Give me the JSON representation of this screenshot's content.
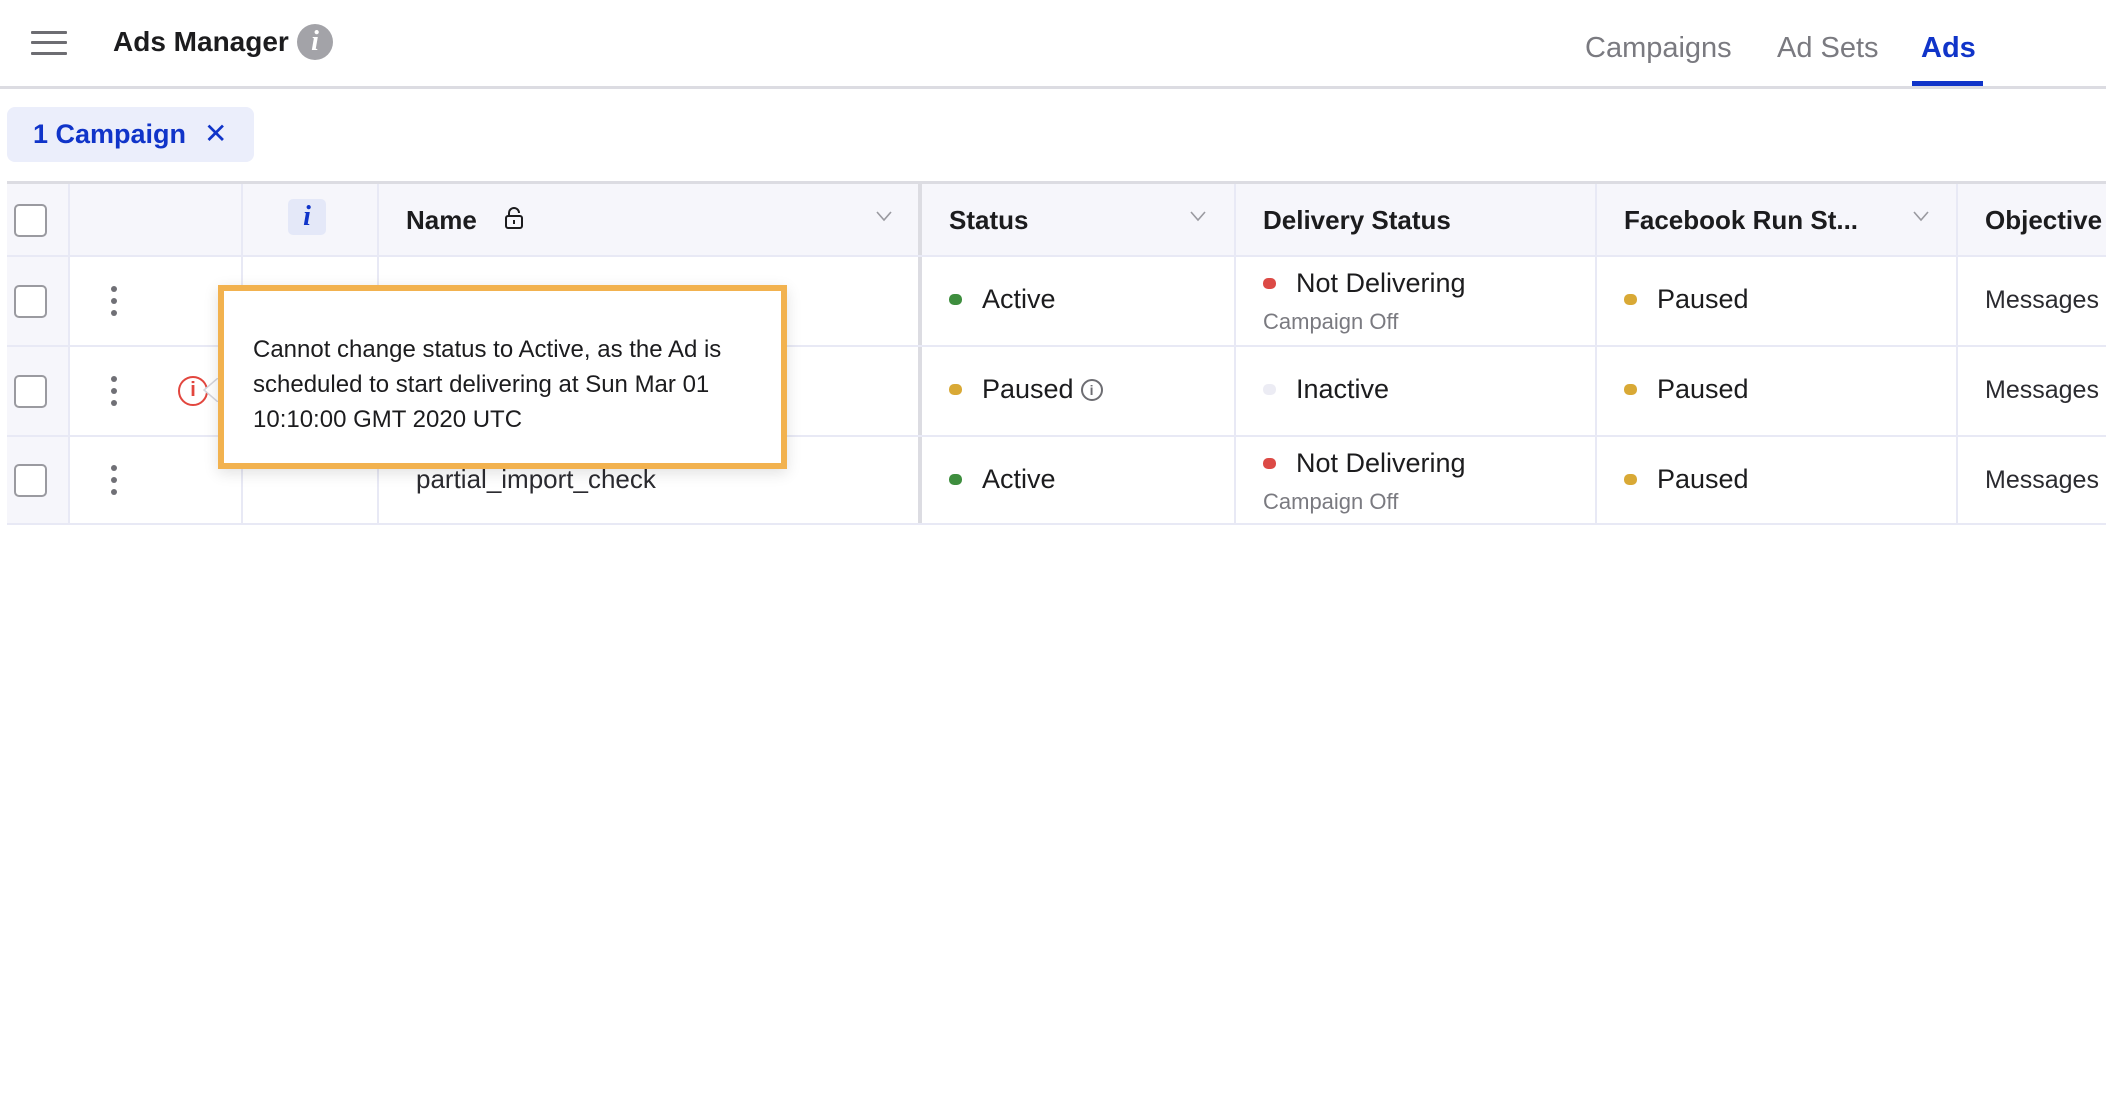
{
  "header": {
    "title": "Ads Manager",
    "title_info_icon": "i"
  },
  "tabs": [
    {
      "label": "Campaigns",
      "active": false
    },
    {
      "label": "Ad Sets",
      "active": false
    },
    {
      "label": "Ads",
      "active": true
    }
  ],
  "filter_chip": {
    "label": "1 Campaign",
    "close_glyph": "✕"
  },
  "colors": {
    "accent": "#1034c9",
    "active": "#3e8e3e",
    "paused": "#d9a935",
    "not_delivering": "#dc4a46",
    "inactive": "#ececf4",
    "error": "#e2463e",
    "tooltip_border": "#f2b24f"
  },
  "table": {
    "columns": [
      {
        "key": "select",
        "label": ""
      },
      {
        "key": "actions",
        "label": ""
      },
      {
        "key": "info",
        "label": "i"
      },
      {
        "key": "name",
        "label": "Name"
      },
      {
        "key": "status",
        "label": "Status"
      },
      {
        "key": "delivery_status",
        "label": "Delivery Status"
      },
      {
        "key": "facebook_run_status",
        "label": "Facebook Run St..."
      },
      {
        "key": "objective",
        "label": "Objective"
      }
    ],
    "rows": [
      {
        "name": "",
        "status": "Active",
        "delivery_status": "Not Delivering",
        "delivery_sub": "Campaign Off",
        "facebook_run_status": "Paused",
        "objective": "Messages"
      },
      {
        "name": "",
        "status": "Paused",
        "delivery_status": "Inactive",
        "delivery_sub": "",
        "facebook_run_status": "Paused",
        "objective": "Messages",
        "error_icon": "i"
      },
      {
        "name": "partial_import_check",
        "status": "Active",
        "delivery_status": "Not Delivering",
        "delivery_sub": "Campaign Off",
        "facebook_run_status": "Paused",
        "objective": "Messages"
      }
    ]
  },
  "tooltip": {
    "text": "Cannot change status to Active, as the Ad is scheduled to start delivering at Sun Mar 01 10:10:00 GMT 2020 UTC"
  },
  "icons": {
    "small_info": "i"
  }
}
